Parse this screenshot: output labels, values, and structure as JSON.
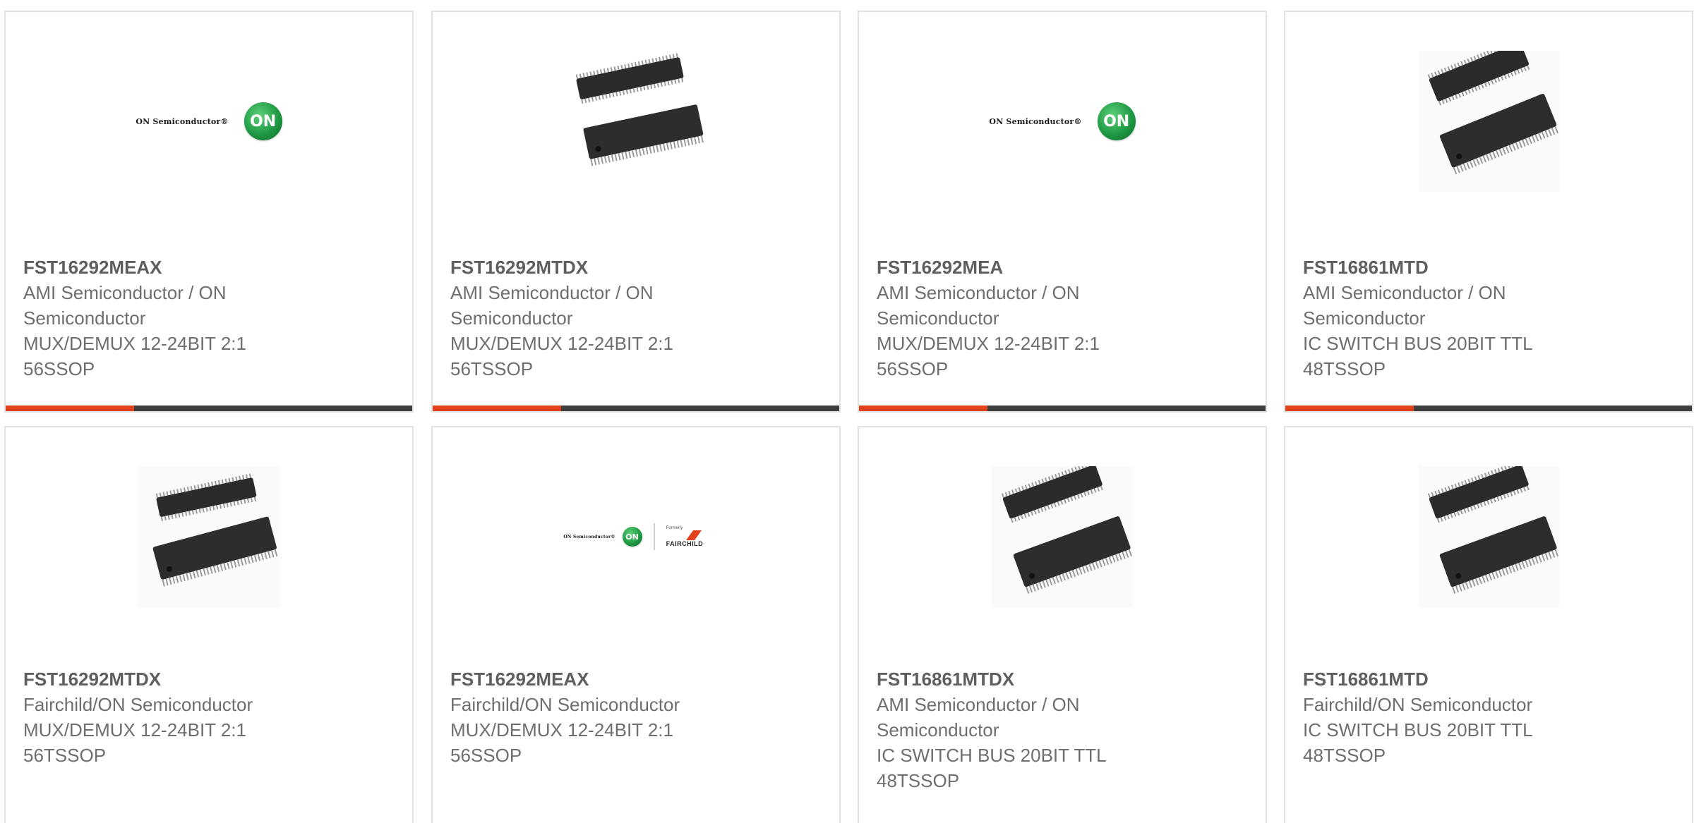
{
  "brand_colors": {
    "accent": "#e2421b",
    "bar": "#3f3f3f",
    "border": "#e2e2e2"
  },
  "logos": {
    "on_text": "ON Semiconductor®",
    "on_badge": "ON",
    "fair_small": "Formerly",
    "fair_name": "FAIRCHILD"
  },
  "products": [
    {
      "part": "FST16292MEAX",
      "manufacturer": "AMI Semiconductor / ON Semiconductor",
      "description": "MUX/DEMUX 12-24BIT 2:1 56SSOP",
      "image": "on-semiconductor-logo"
    },
    {
      "part": "FST16292MTDX",
      "manufacturer": "AMI Semiconductor / ON Semiconductor",
      "description": "MUX/DEMUX 12-24BIT 2:1 56TSSOP",
      "image": "chip-package"
    },
    {
      "part": "FST16292MEA",
      "manufacturer": "AMI Semiconductor / ON Semiconductor",
      "description": "MUX/DEMUX 12-24BIT 2:1 56SSOP",
      "image": "on-semiconductor-logo"
    },
    {
      "part": "FST16861MTD",
      "manufacturer": "AMI Semiconductor / ON Semiconductor",
      "description": "IC SWITCH BUS 20BIT TTL 48TSSOP",
      "image": "chip-package"
    },
    {
      "part": "FST16292MTDX",
      "manufacturer": "Fairchild/ON Semiconductor",
      "description": "MUX/DEMUX 12-24BIT 2:1 56TSSOP",
      "image": "chip-package"
    },
    {
      "part": "FST16292MEAX",
      "manufacturer": "Fairchild/ON Semiconductor",
      "description": "MUX/DEMUX 12-24BIT 2:1 56SSOP",
      "image": "on-fairchild-logo"
    },
    {
      "part": "FST16861MTDX",
      "manufacturer": "AMI Semiconductor / ON Semiconductor",
      "description": "IC SWITCH BUS 20BIT TTL 48TSSOP",
      "image": "chip-package"
    },
    {
      "part": "FST16861MTD",
      "manufacturer": "Fairchild/ON Semiconductor",
      "description": "IC SWITCH BUS 20BIT TTL 48TSSOP",
      "image": "chip-package"
    }
  ]
}
